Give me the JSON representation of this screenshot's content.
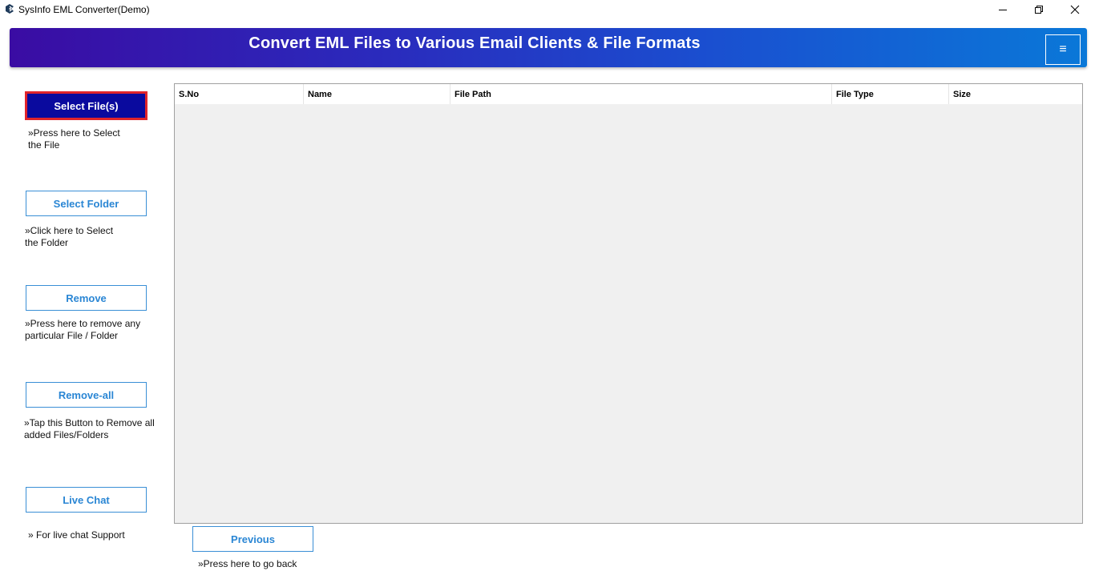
{
  "window": {
    "title": "SysInfo EML Converter(Demo)",
    "icon": "sysinfo-logo-icon",
    "controls": [
      "minimize-icon",
      "maximize-icon",
      "close-icon"
    ]
  },
  "header": {
    "title": "Convert EML Files to Various Email Clients & File Formats",
    "menu_icon": "≡"
  },
  "sidebar": {
    "select_files": {
      "label": "Select File(s)",
      "hint": "»Press here to Select\nthe File"
    },
    "select_folder": {
      "label": "Select Folder",
      "hint": "»Click here to Select\nthe Folder"
    },
    "remove": {
      "label": "Remove",
      "hint": "»Press here to remove any\nparticular File / Folder"
    },
    "remove_all": {
      "label": "Remove-all",
      "hint": "»Tap this Button to Remove all\nadded Files/Folders"
    },
    "live_chat": {
      "label": "Live Chat",
      "hint": "» For live chat Support"
    }
  },
  "table": {
    "columns": [
      "S.No",
      "Name",
      "File Path",
      "File Type",
      "Size"
    ],
    "rows": []
  },
  "footer": {
    "previous": {
      "label": "Previous",
      "hint": "»Press here to go back"
    }
  },
  "colors": {
    "banner_start": "#3a0ca3",
    "banner_end": "#0a78d8",
    "primary_button": "#0a0a9e",
    "primary_border": "#e0242b",
    "accent_text": "#2a86d4"
  }
}
